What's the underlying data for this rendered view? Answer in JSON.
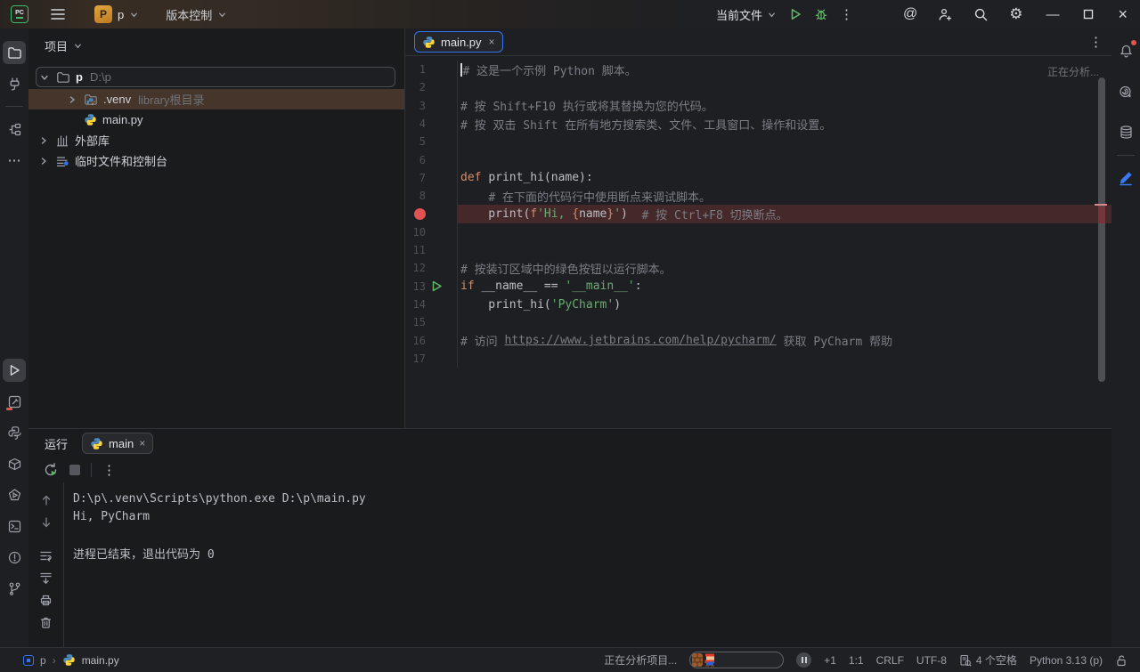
{
  "colors": {
    "accent_blue": "#3574f0",
    "run_green": "#5fb865",
    "breakpoint_red": "#e35252",
    "keyword_orange": "#cf8e6d",
    "string_green": "#6aab73",
    "comment_gray": "#7a7e85",
    "selection_brown": "#45352b"
  },
  "icons": {
    "kebab": "⋮",
    "ellipsis": "⋯",
    "close": "×",
    "minimize": "—",
    "at": "@",
    "gear": "⚙",
    "breadcrumb_sep": "›"
  },
  "titlebar": {
    "logo_text": "PC",
    "project_badge": "P",
    "project_name": "p",
    "vcs_label": "版本控制",
    "run_config_label": "当前文件"
  },
  "project_panel": {
    "title": "项目",
    "items": [
      {
        "level": 0,
        "chevron": "down",
        "icon": "folder",
        "name": "p",
        "hint": "D:\\p",
        "bold": true,
        "focus": true,
        "selected": false
      },
      {
        "level": 1,
        "chevron": "right",
        "icon": "venv-folder",
        "name": ".venv",
        "hint": "library根目录",
        "bold": false,
        "focus": false,
        "selected": true
      },
      {
        "level": 1,
        "chevron": null,
        "icon": "python-file",
        "name": "main.py",
        "hint": "",
        "bold": false,
        "focus": false,
        "selected": false
      },
      {
        "level": 0,
        "chevron": "right",
        "icon": "library",
        "name": "外部库",
        "hint": "",
        "bold": false,
        "focus": false,
        "selected": false
      },
      {
        "level": 0,
        "chevron": "right",
        "icon": "scratches",
        "name": "临时文件和控制台",
        "hint": "",
        "bold": false,
        "focus": false,
        "selected": false
      }
    ]
  },
  "editor": {
    "tab_label": "main.py",
    "analyzing": "正在分析...",
    "lines": [
      {
        "n": "1",
        "caret": true,
        "gutter": null,
        "highlight": false,
        "tokens": [
          [
            "cm",
            "# 这是一个示例 Python 脚本。"
          ]
        ]
      },
      {
        "n": "2",
        "caret": false,
        "gutter": null,
        "highlight": false,
        "tokens": []
      },
      {
        "n": "3",
        "caret": false,
        "gutter": null,
        "highlight": false,
        "tokens": [
          [
            "cm",
            "# 按 Shift+F10 执行或将其替换为您的代码。"
          ]
        ]
      },
      {
        "n": "4",
        "caret": false,
        "gutter": null,
        "highlight": false,
        "tokens": [
          [
            "cm",
            "# 按 双击 Shift 在所有地方搜索类、文件、工具窗口、操作和设置。"
          ]
        ]
      },
      {
        "n": "5",
        "caret": false,
        "gutter": null,
        "highlight": false,
        "tokens": []
      },
      {
        "n": "6",
        "caret": false,
        "gutter": null,
        "highlight": false,
        "tokens": []
      },
      {
        "n": "7",
        "caret": false,
        "gutter": null,
        "highlight": false,
        "tokens": [
          [
            "kw",
            "def "
          ],
          [
            "tx",
            "print_hi(name):"
          ]
        ]
      },
      {
        "n": "8",
        "caret": false,
        "gutter": null,
        "highlight": false,
        "tokens": [
          [
            "tx",
            "    "
          ],
          [
            "cm",
            "# 在下面的代码行中使用断点来调试脚本。"
          ]
        ]
      },
      {
        "n": "9",
        "caret": false,
        "gutter": "breakpoint",
        "highlight": true,
        "tokens": [
          [
            "tx",
            "    print("
          ],
          [
            "kw",
            "f"
          ],
          [
            "st",
            "'Hi, "
          ],
          [
            "br",
            "{"
          ],
          [
            "tx",
            "name"
          ],
          [
            "br",
            "}"
          ],
          [
            "st",
            "'"
          ],
          [
            "tx",
            ")  "
          ],
          [
            "cm",
            "# 按 Ctrl+F8 切换断点。"
          ]
        ]
      },
      {
        "n": "10",
        "caret": false,
        "gutter": null,
        "highlight": false,
        "tokens": []
      },
      {
        "n": "11",
        "caret": false,
        "gutter": null,
        "highlight": false,
        "tokens": []
      },
      {
        "n": "12",
        "caret": false,
        "gutter": null,
        "highlight": false,
        "tokens": [
          [
            "cm",
            "# 按装订区域中的绿色按钮以运行脚本。"
          ]
        ]
      },
      {
        "n": "13",
        "caret": false,
        "gutter": "run",
        "highlight": false,
        "tokens": [
          [
            "kw",
            "if "
          ],
          [
            "tx",
            "__name__ == "
          ],
          [
            "st",
            "'__main__'"
          ],
          [
            "tx",
            ":"
          ]
        ]
      },
      {
        "n": "14",
        "caret": false,
        "gutter": null,
        "highlight": false,
        "tokens": [
          [
            "tx",
            "    print_hi("
          ],
          [
            "st",
            "'PyCharm'"
          ],
          [
            "tx",
            ")"
          ]
        ]
      },
      {
        "n": "15",
        "caret": false,
        "gutter": null,
        "highlight": false,
        "tokens": []
      },
      {
        "n": "16",
        "caret": false,
        "gutter": null,
        "highlight": false,
        "tokens": [
          [
            "cm",
            "# 访问 "
          ],
          [
            "lk",
            "https://www.jetbrains.com/help/pycharm/"
          ],
          [
            "cm",
            " 获取 PyCharm 帮助"
          ]
        ]
      },
      {
        "n": "17",
        "caret": false,
        "gutter": null,
        "highlight": false,
        "tokens": []
      }
    ]
  },
  "run_panel": {
    "title": "运行",
    "tab_label": "main",
    "console": [
      "D:\\p\\.venv\\Scripts\\python.exe D:\\p\\main.py",
      "Hi, PyCharm",
      "",
      "进程已结束，退出代码为 0"
    ]
  },
  "status_bar": {
    "project": "p",
    "file": "main.py",
    "analyzing": "正在分析项目...",
    "extra_count": "+1",
    "caret_pos": "1:1",
    "line_separator": "CRLF",
    "encoding": "UTF-8",
    "indent": "4 个空格",
    "interpreter": "Python 3.13 (p)"
  }
}
